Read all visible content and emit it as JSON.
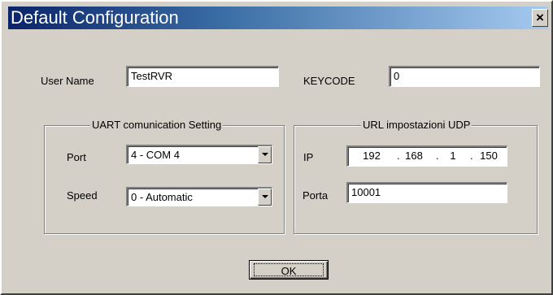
{
  "window": {
    "title": "Default Configuration",
    "close_glyph": "×"
  },
  "user": {
    "label": "User Name",
    "value": "TestRVR"
  },
  "keycode": {
    "label": "KEYCODE",
    "value": "0"
  },
  "uart": {
    "title": "UART comunication Setting",
    "port_label": "Port",
    "port_value": "4 - COM 4",
    "speed_label": "Speed",
    "speed_value": "0 - Automatic"
  },
  "udp": {
    "title": "URL impostazioni UDP",
    "ip_label": "IP",
    "ip": [
      "192",
      "168",
      "1",
      "150"
    ],
    "ip_separator": ".",
    "porta_label": "Porta",
    "porta_value": "10001"
  },
  "buttons": {
    "ok_label": "OK"
  },
  "icons": {
    "close": "close-icon",
    "dropdown": "chevron-down-icon"
  },
  "colors": {
    "title_bar_start": "#0a246a",
    "title_bar_end": "#a6caf0",
    "dialog_face": "#d4d0c8"
  }
}
